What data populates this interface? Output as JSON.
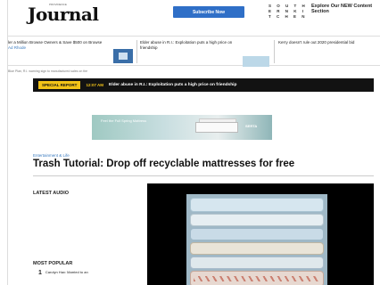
{
  "header": {
    "masthead": "Journal",
    "masthead_small": "PROVIDENCE",
    "subscribe_label": "Subscribe Now",
    "sk_logo": "S O U T H E R N  K I T C H E N",
    "sk_promo": "Explore Our NEW Content Section"
  },
  "strip": {
    "item1": "ler a Million Browse Owners & Save $500 on Browse",
    "item1_sub": "Ad Rhode",
    "item2": "Elder abuse in R.I.: Exploitation puts a high price on friendship",
    "item3": "Kerry doesn't rule out 2020 presidential bid",
    "subline": "Blue Plan, R.I. warning sign to manufactured sales on the"
  },
  "report": {
    "badge": "SPECIAL REPORT",
    "time": "12:07 AM",
    "headline": "Elder abuse in R.I.: Exploitation puts a high price on friendship"
  },
  "ad": {
    "text": "Feel the Full Spring Mattress",
    "brand": "SERTA"
  },
  "article": {
    "category": "Entertainment & Life",
    "title": "Trash Tutorial: Drop off recyclable mattresses for free"
  },
  "sidebar": {
    "latest_audio": "LATEST AUDIO",
    "most_popular": "MOST POPULAR",
    "popular_items": [
      {
        "num": "1",
        "text": "Carolyn Hax: Married to an"
      }
    ]
  },
  "colors": {
    "accent_blue": "#2f6fc7",
    "report_yellow": "#f2c318",
    "report_bg": "#121212"
  }
}
